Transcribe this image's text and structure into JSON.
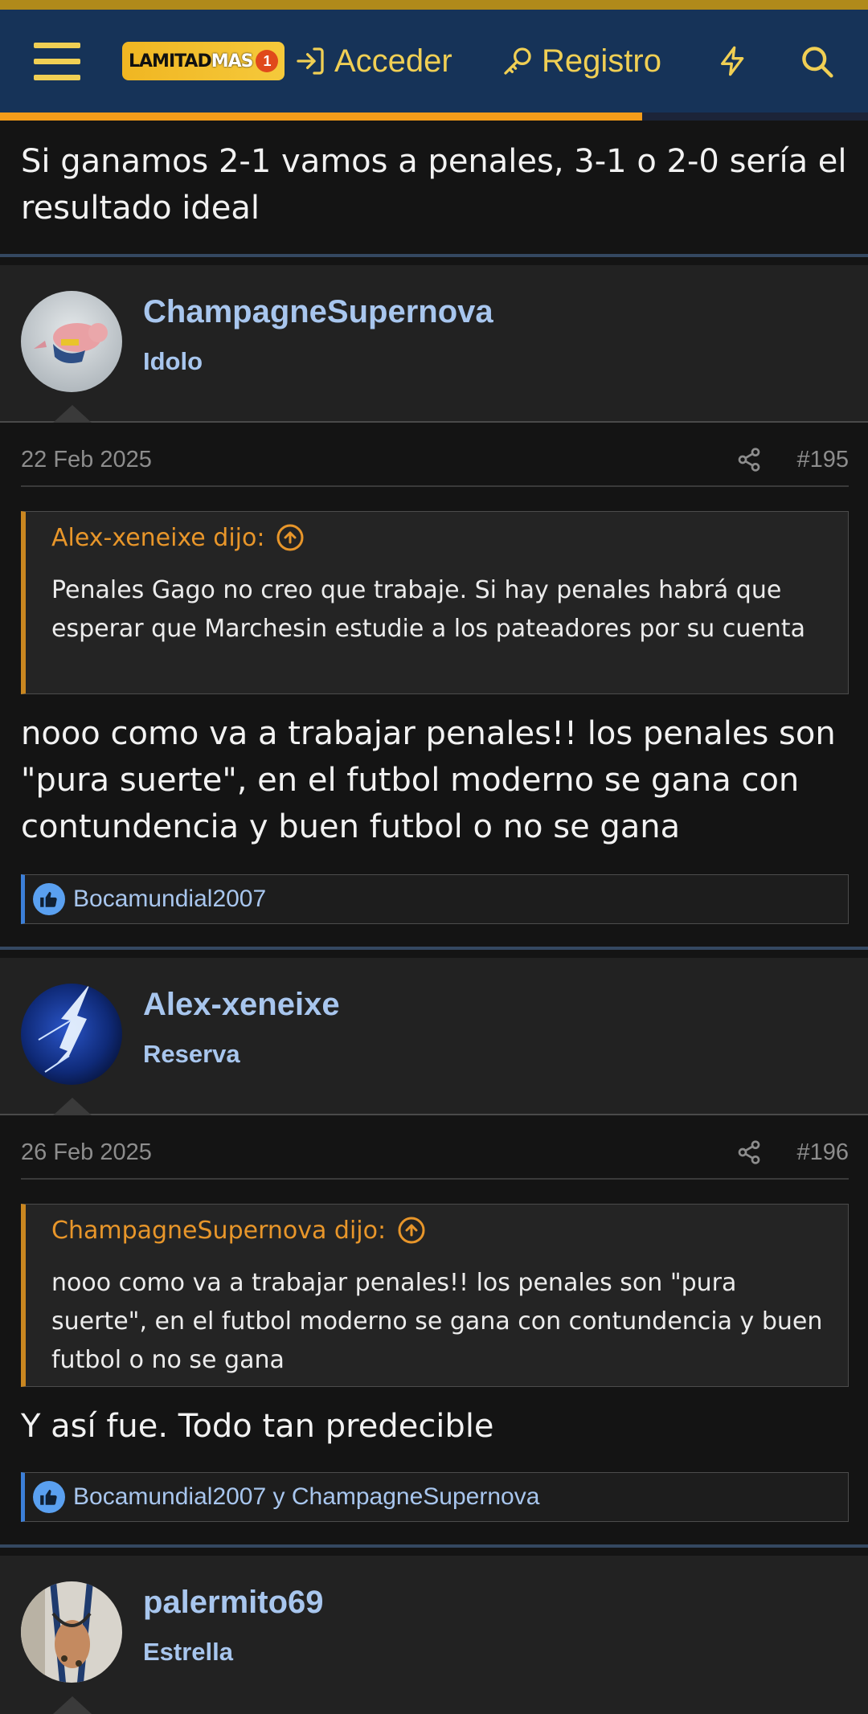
{
  "header": {
    "logo_text_part1": "LAMITAD",
    "logo_text_part2": "MAS",
    "logo_text_part3": "1",
    "login_label": "Acceder",
    "register_label": "Registro",
    "scroll_progress": 0.74,
    "colors": {
      "bar": "#163358",
      "accent": "#f0cf54",
      "progress": "#f39c1a"
    }
  },
  "previous_post": {
    "text": "Si ganamos 2-1 vamos a penales, 3-1 o 2-0 sería el resultado ideal"
  },
  "posts": [
    {
      "username": "ChampagneSupernova",
      "role": "Idolo",
      "avatar_icon": "flying-pig-avatar",
      "date": "22 Feb 2025",
      "number": "#195",
      "quote_author": "Alex-xeneixe dijo:",
      "quote_text": "Penales Gago no creo que trabaje. Si hay penales habrá que esperar que Marchesin estudie a los pateadores por su cuenta",
      "text": "nooo como va a trabajar penales!! los penales son \"pura suerte\", en el futbol moderno se gana con contundencia y buen futbol o no se gana",
      "reactions": "Bocamundial2007"
    },
    {
      "username": "Alex-xeneixe",
      "role": "Reserva",
      "avatar_icon": "lightning-avatar",
      "date": "26 Feb 2025",
      "number": "#196",
      "quote_author": "ChampagneSupernova dijo:",
      "quote_text": "nooo como va a trabajar penales!! los penales son \"pura suerte\", en el futbol moderno se gana con contundencia y buen futbol o no se gana",
      "text": "Y así fue. Todo tan predecible",
      "reactions": "Bocamundial2007 y ChampagneSupernova"
    },
    {
      "username": "palermito69",
      "role": "Estrella",
      "avatar_icon": "photo-avatar"
    }
  ]
}
